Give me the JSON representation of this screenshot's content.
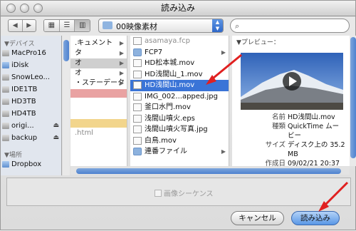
{
  "window": {
    "title": "読み込み"
  },
  "toolbar": {
    "back": "◀",
    "forward": "▶",
    "location": "00映像素材",
    "search_placeholder": ""
  },
  "sidebar": {
    "devices_header": "▼デバイス",
    "devices": [
      {
        "label": "MacPro16",
        "eject": false
      },
      {
        "label": "iDisk",
        "eject": false
      },
      {
        "label": "SnowLeo...",
        "eject": false
      },
      {
        "label": "IDE1TB",
        "eject": false
      },
      {
        "label": "HD3TB",
        "eject": false
      },
      {
        "label": "HD4TB",
        "eject": false
      },
      {
        "label": "origi...",
        "eject": true
      },
      {
        "label": "backup",
        "eject": true
      }
    ],
    "places_header": "▼場所",
    "places": [
      {
        "label": "Dropbox"
      }
    ]
  },
  "column1": {
    "items": [
      ".キュメント",
      "タ",
      "オ",
      "オ",
      "・ステーデータ",
      "",
      "",
      "",
      "",
      ".html"
    ]
  },
  "column2": {
    "items": [
      {
        "label": "asamaya.fcp",
        "type": "file",
        "grey": true
      },
      {
        "label": "FCP7",
        "type": "folder"
      },
      {
        "label": "HD松本城.mov",
        "type": "file"
      },
      {
        "label": "HD浅間山_1.mov",
        "type": "file"
      },
      {
        "label": "HD浅間山.mov",
        "type": "file",
        "selected": true
      },
      {
        "label": "IMG_002...apped.jpg",
        "type": "file"
      },
      {
        "label": "釜口水門.mov",
        "type": "file"
      },
      {
        "label": "浅間山噴火.eps",
        "type": "file"
      },
      {
        "label": "浅間山噴火写真.jpg",
        "type": "file"
      },
      {
        "label": "白鳥.mov",
        "type": "file"
      },
      {
        "label": "連番ファイル",
        "type": "folder"
      }
    ]
  },
  "preview": {
    "title": "▼プレビュー：",
    "meta": [
      {
        "k": "名前",
        "v": "HD浅間山.mov"
      },
      {
        "k": "種類",
        "v": "QuickTime ムー"
      },
      {
        "k": "",
        "v": "ビー"
      },
      {
        "k": "サイズ",
        "v": "ディスク上の 35.2"
      },
      {
        "k": "",
        "v": "MB"
      },
      {
        "k": "作成日",
        "v": "09/02/21 20:37"
      }
    ]
  },
  "options": {
    "image_sequence": "画像シーケンス"
  },
  "buttons": {
    "cancel": "キャンセル",
    "open": "読み込み"
  }
}
